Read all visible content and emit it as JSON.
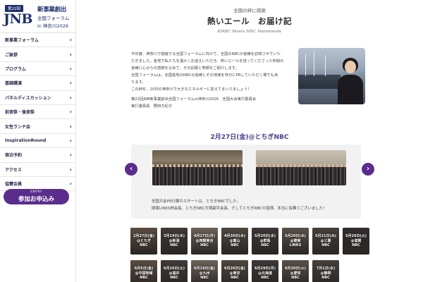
{
  "logo": {
    "badge": "第22回",
    "mark": "JNB",
    "line1": "新事業創出",
    "line2": "全国フォーラム",
    "line3": "in 神奈川2026"
  },
  "nav": {
    "items": [
      "新事業フォーラム",
      "ご挨拶",
      "プログラム",
      "基調講演",
      "パネルディスカッション",
      "前夜祭・後夜祭",
      "女性ランチ会",
      "InspirationRound",
      "宿泊予約",
      "アクセス",
      "協賛会員"
    ],
    "entry_small": "ENTRY",
    "entry_big": "参加お申込み"
  },
  "greeting": {
    "subtitle": "全国の絆に感謝",
    "title": "熱いエール　お届け記",
    "english": "KMBC Meets NBC Nationwide",
    "lines": [
      "今年度、神奈川で開催する全国フォーラムに向けて、全国のNBCの皆様を訪問させていた",
      "だきました。各地で私たちを温かくお迎えいただき、熱いエールを送ってくださった仲間の",
      "皆様に心からの感謝を込めて、その記録と笑顔をご紹介します。",
      "全国フォーラムは、全国各地のNBCの皆様とその地域を存分にPRしていただく場でもあ",
      "ります。",
      "この絆を、10月の神奈川で大きなエネルギーに変えてまいりましょう！"
    ],
    "signature1": "第22回JNB新事業創出全国フォーラムin神奈川2026　全国大会実行委員会",
    "signature2": "実行委員長　野田万紀子"
  },
  "slider": {
    "date_heading": "2月27日(金)@とちぎNBC",
    "caption1": "全国大会PR行脚のスタートは、とちぎNBCでした。",
    "caption2": "関東LINKS林会長、とちぎNBC大塚副平会長、そしてとちぎNBCの皆様、本当に有難うございました！",
    "prev_icon": "‹",
    "next_icon": "›"
  },
  "thumbnails": [
    {
      "date": "2月27日(金)",
      "place": "@とちぎ",
      "org": "NBC"
    },
    {
      "date": "3月19日(木)",
      "place": "@新潟",
      "org": "NBC"
    },
    {
      "date": "4月27日(月)",
      "place": "@西関東合",
      "org": "NBC"
    },
    {
      "date": "4月30日(木)",
      "place": "@富山",
      "org": "NBC"
    },
    {
      "date": "5月20日(水)",
      "place": "@群馬",
      "org": "NBC"
    },
    {
      "date": "5月20日(水)",
      "place": "@関東",
      "org": "LINKS"
    },
    {
      "date": "5月21日(木)",
      "place": "@三重",
      "org": "NBC"
    },
    {
      "date": "5月26日(火)",
      "place": "@滋賀",
      "org": "NBC"
    },
    {
      "date": "6月5日(金)",
      "place": "@中国地域",
      "org": "NBC"
    },
    {
      "date": "6月16日(火)",
      "place": "@福井",
      "org": "NBC"
    },
    {
      "date": "6月19日(金)",
      "place": "@九州",
      "org": "NBC"
    },
    {
      "date": "6月26日(金)",
      "place": "@東京",
      "org": "NBC"
    },
    {
      "date": "6月29日(月)",
      "place": "@北海道",
      "org": "NBC"
    },
    {
      "date": "6月30日(火)",
      "place": "@愛知",
      "org": "NBC"
    },
    {
      "date": "7月1日(水)",
      "place": "@静岡",
      "org": "NBC"
    }
  ],
  "colors": {
    "brand_navy": "#1f2f6b",
    "accent_purple": "#5a2d8c"
  }
}
